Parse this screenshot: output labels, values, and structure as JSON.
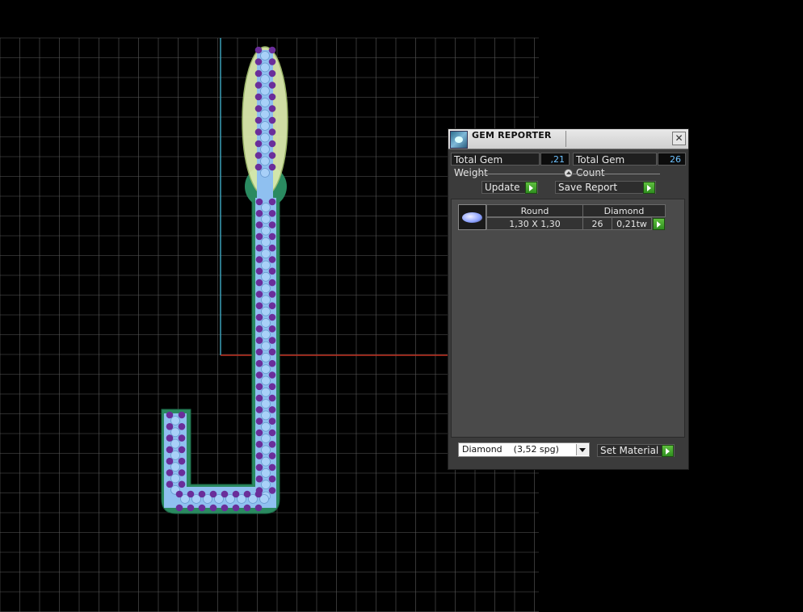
{
  "panel": {
    "title": "GEM REPORTER",
    "close_glyph": "✕",
    "total_weight_label": "Total Gem Weight",
    "total_weight_value": ",21",
    "total_count_label": "Total Gem Count",
    "total_count_value": "26",
    "update_label": "Update",
    "save_report_label": "Save Report",
    "gem_table": {
      "headers": [
        "Round",
        "Diamond"
      ],
      "row": {
        "size": "1,30 X 1,30",
        "count": "26",
        "weight": "0,21tw"
      }
    },
    "material_select_value": "Diamond    (3,52 spg)",
    "set_material_label": "Set Material"
  },
  "colors": {
    "grid": "#5a5a5a",
    "x_axis": "#c03020",
    "y_axis": "#3aa0b8",
    "prong": "#6a2e9a",
    "gem_seat": "#8fc0f0",
    "shank": "#2a8a60",
    "ellipse": "#dfeeb0",
    "value_text": "#6fc3ff",
    "go_button": "#3f9f2f"
  },
  "icons": {
    "app_logo": "gem-reporter-logo-icon",
    "close": "close-icon",
    "go": "green-arrow-icon",
    "gem": "round-gem-icon",
    "dropdown": "chevron-down-icon"
  }
}
